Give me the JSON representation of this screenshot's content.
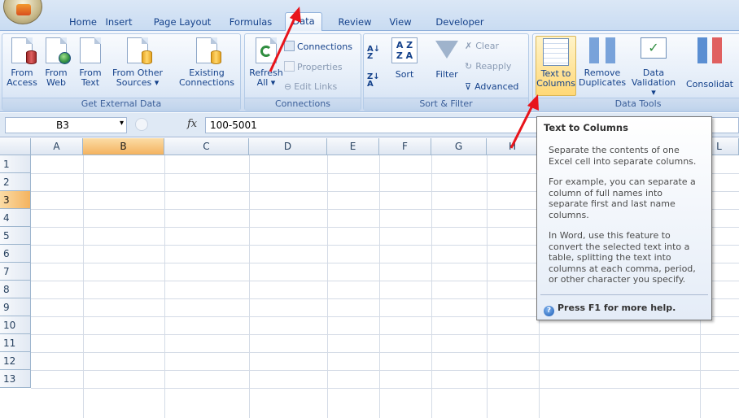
{
  "tabs": [
    "Home",
    "Insert",
    "Page Layout",
    "Formulas",
    "Data",
    "Review",
    "View",
    "Developer"
  ],
  "active_tab": "Data",
  "ribbon": {
    "get_external": {
      "group_label": "Get External Data",
      "from_access": [
        "From",
        "Access"
      ],
      "from_web": [
        "From",
        "Web"
      ],
      "from_text": [
        "From",
        "Text"
      ],
      "from_other": [
        "From Other",
        "Sources ▾"
      ],
      "existing": [
        "Existing",
        "Connections"
      ]
    },
    "connections": {
      "group_label": "Connections",
      "refresh": [
        "Refresh",
        "All ▾"
      ],
      "connections": "Connections",
      "properties": "Properties",
      "edit_links": "Edit Links"
    },
    "sort_filter": {
      "group_label": "Sort & Filter",
      "sort": "Sort",
      "filter": "Filter",
      "clear": "Clear",
      "reapply": "Reapply",
      "advanced": "Advanced"
    },
    "data_tools": {
      "group_label": "Data Tools",
      "text_to_columns": [
        "Text to",
        "Columns"
      ],
      "remove_duplicates": [
        "Remove",
        "Duplicates"
      ],
      "data_validation": [
        "Data",
        "Validation ▾"
      ],
      "consolidate": "Consolidat"
    }
  },
  "formula_bar": {
    "name_box": "B3",
    "fx": "fx",
    "value": "100-5001"
  },
  "columns": [
    "A",
    "B",
    "C",
    "D",
    "E",
    "F",
    "G",
    "H",
    "L"
  ],
  "selected_column": "B",
  "rows": [
    "1",
    "2",
    "3",
    "4",
    "5",
    "6",
    "7",
    "8",
    "9",
    "10",
    "11",
    "12",
    "13"
  ],
  "selected_row": "3",
  "tooltip": {
    "title": "Text to Columns",
    "p1": "Separate the contents of one Excel cell into separate columns.",
    "p2": "For example, you can separate a column of full names into separate first and last name columns.",
    "p3": "In Word, use this feature to convert the selected text into a table, splitting the text into columns at each comma, period, or other character you specify.",
    "help": "Press F1 for more help."
  },
  "colors": {
    "accent": "#15428b",
    "arrow": "#e8141b",
    "selection": "#f4b35f"
  },
  "icons": [
    "office-button-icon",
    "database-icon",
    "globe-icon",
    "sort-az-icon",
    "funnel-icon",
    "help-icon"
  ]
}
